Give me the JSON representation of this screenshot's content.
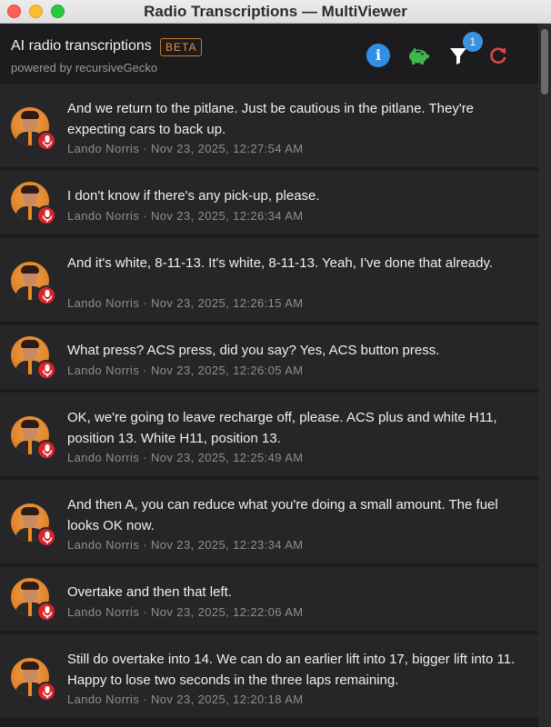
{
  "window": {
    "title": "Radio Transcriptions — MultiViewer"
  },
  "header": {
    "title": "AI radio transcriptions",
    "badge": "BETA",
    "subtitle": "powered by recursiveGecko",
    "info_glyph": "i",
    "filter_count": "1",
    "icons": [
      "info-icon",
      "piggy-bank-icon",
      "filter-icon",
      "refresh-icon"
    ],
    "colors": {
      "info": "#2f8fe3",
      "piggy": "#3fb54f",
      "refresh": "#e2483d",
      "badge": "#3a93e0"
    }
  },
  "transcriptions": [
    {
      "text": "And we return to the pitlane. Just be cautious in the pitlane. They're expecting cars to back up.",
      "meta": "Lando Norris · Nov 23, 2025, 12:27:54 AM"
    },
    {
      "text": "I don't know if there's any pick-up, please.",
      "meta": "Lando Norris · Nov 23, 2025, 12:26:34 AM"
    },
    {
      "text": "And it's white, 8-11-13. It's white, 8-11-13. Yeah, I've done that already.",
      "meta": "Lando Norris · Nov 23, 2025, 12:26:15 AM"
    },
    {
      "text": "What press? ACS press, did you say? Yes, ACS button press.",
      "meta": "Lando Norris · Nov 23, 2025, 12:26:05 AM"
    },
    {
      "text": "OK, we're going to leave recharge off, please. ACS plus and white H11, position 13. White H11, position 13.",
      "meta": "Lando Norris · Nov 23, 2025, 12:25:49 AM"
    },
    {
      "text": "And then A, you can reduce what you're doing a small amount. The fuel looks OK now.",
      "meta": "Lando Norris · Nov 23, 2025, 12:23:34 AM"
    },
    {
      "text": "Overtake and then that left.",
      "meta": "Lando Norris · Nov 23, 2025, 12:22:06 AM"
    },
    {
      "text": "Still do overtake into 14. We can do an earlier lift into 17, bigger lift into 11. Happy to lose two seconds in the three laps remaining.",
      "meta": "Lando Norris · Nov 23, 2025, 12:20:18 AM"
    }
  ]
}
